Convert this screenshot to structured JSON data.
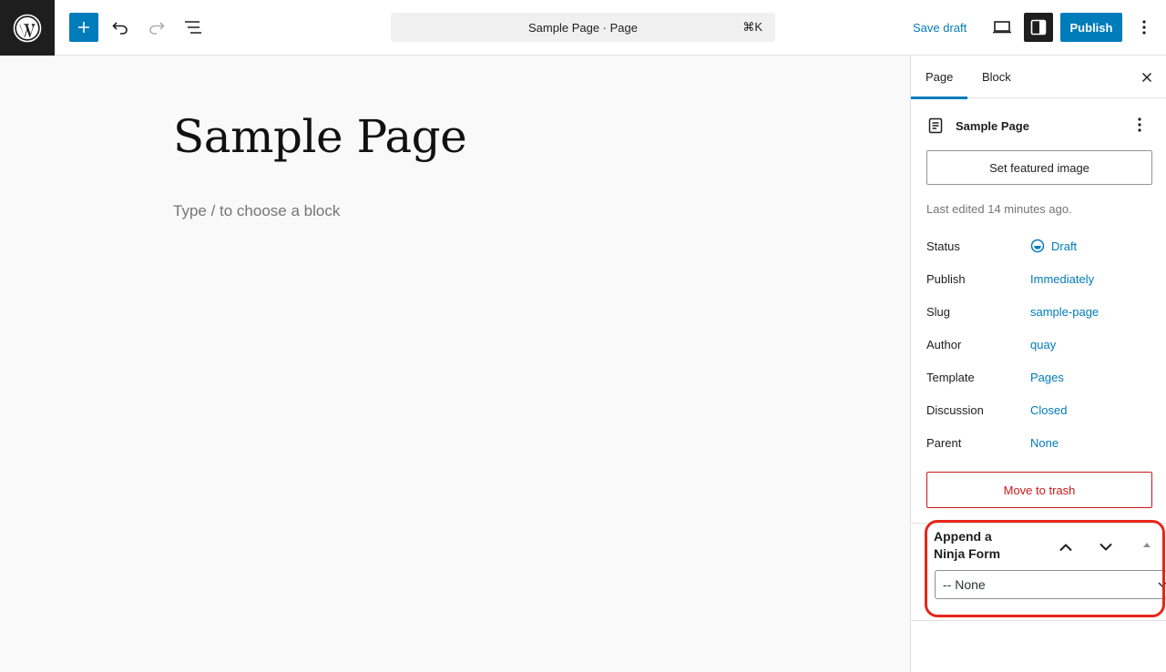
{
  "colors": {
    "accent": "#007cba",
    "danger": "#cc1818",
    "highlight": "#e8261b"
  },
  "toolbar": {
    "add_icon": "plus-icon",
    "undo_icon": "undo-icon",
    "redo_icon": "redo-icon",
    "listview_icon": "list-view-icon",
    "command_title": "Sample Page · Page",
    "command_shortcut": "⌘K",
    "save_draft_label": "Save draft",
    "preview_icon": "desktop-preview-icon",
    "settings_icon": "sidebar-toggle-icon",
    "publish_label": "Publish",
    "options_icon": "more-vertical-icon"
  },
  "canvas": {
    "title": "Sample Page",
    "placeholder": "Type / to choose a block"
  },
  "sidebar": {
    "tabs": [
      {
        "label": "Page"
      },
      {
        "label": "Block"
      }
    ],
    "close_icon": "close-icon",
    "doc_title": "Sample Page",
    "featured_image_label": "Set featured image",
    "last_edited": "Last edited 14 minutes ago.",
    "meta": [
      {
        "label": "Status",
        "value": "Draft"
      },
      {
        "label": "Publish",
        "value": "Immediately"
      },
      {
        "label": "Slug",
        "value": "sample-page"
      },
      {
        "label": "Author",
        "value": "quay"
      },
      {
        "label": "Template",
        "value": "Pages"
      },
      {
        "label": "Discussion",
        "value": "Closed"
      },
      {
        "label": "Parent",
        "value": "None"
      }
    ],
    "trash_label": "Move to trash",
    "ninja": {
      "title_line1": "Append a",
      "title_line2": "Ninja Form",
      "selected": "-- None"
    }
  }
}
